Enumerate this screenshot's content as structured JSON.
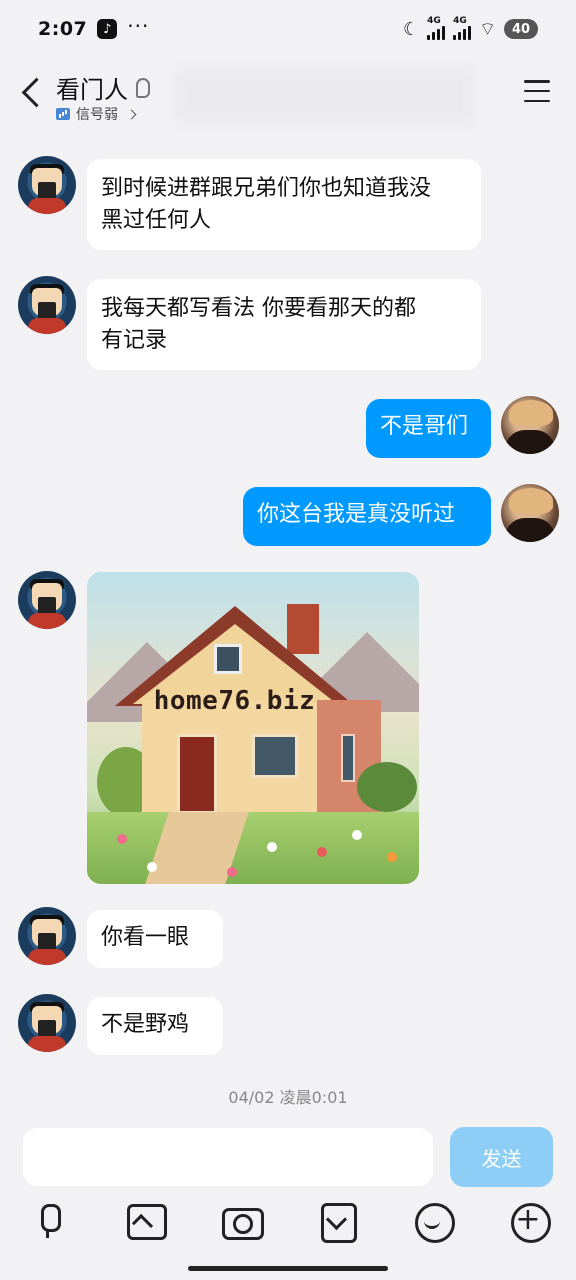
{
  "status_bar": {
    "time": "2:07",
    "network1": "4G",
    "network2": "4G",
    "battery": "40"
  },
  "header": {
    "title": "看门人",
    "subtitle": "信号弱"
  },
  "messages": [
    {
      "side": "left",
      "text_line1": "到时候进群跟兄弟们你也知道我没",
      "text_line2": "黑过任何人"
    },
    {
      "side": "left",
      "text_line1": "我每天都写看法 你要看那天的都",
      "text_line2": "有记录"
    },
    {
      "side": "right",
      "text": "不是哥们"
    },
    {
      "side": "right",
      "text": "你这台我是真没听过"
    },
    {
      "side": "left",
      "type": "image",
      "image_text": "home76.biz"
    },
    {
      "side": "left",
      "text": "你看一眼"
    },
    {
      "side": "left",
      "text": "不是野鸡"
    }
  ],
  "timestamp": "04/02 凌晨0:01",
  "composer": {
    "input_value": "",
    "send_label": "发送"
  },
  "toolbar": {
    "icons": [
      "mic-icon",
      "image-icon",
      "camera-icon",
      "pocket-icon",
      "emoji-icon",
      "plus-icon"
    ]
  },
  "colors": {
    "outgoing_bubble": "#0099ff",
    "send_button": "#8ecdf6",
    "background": "#f2f2f4"
  }
}
